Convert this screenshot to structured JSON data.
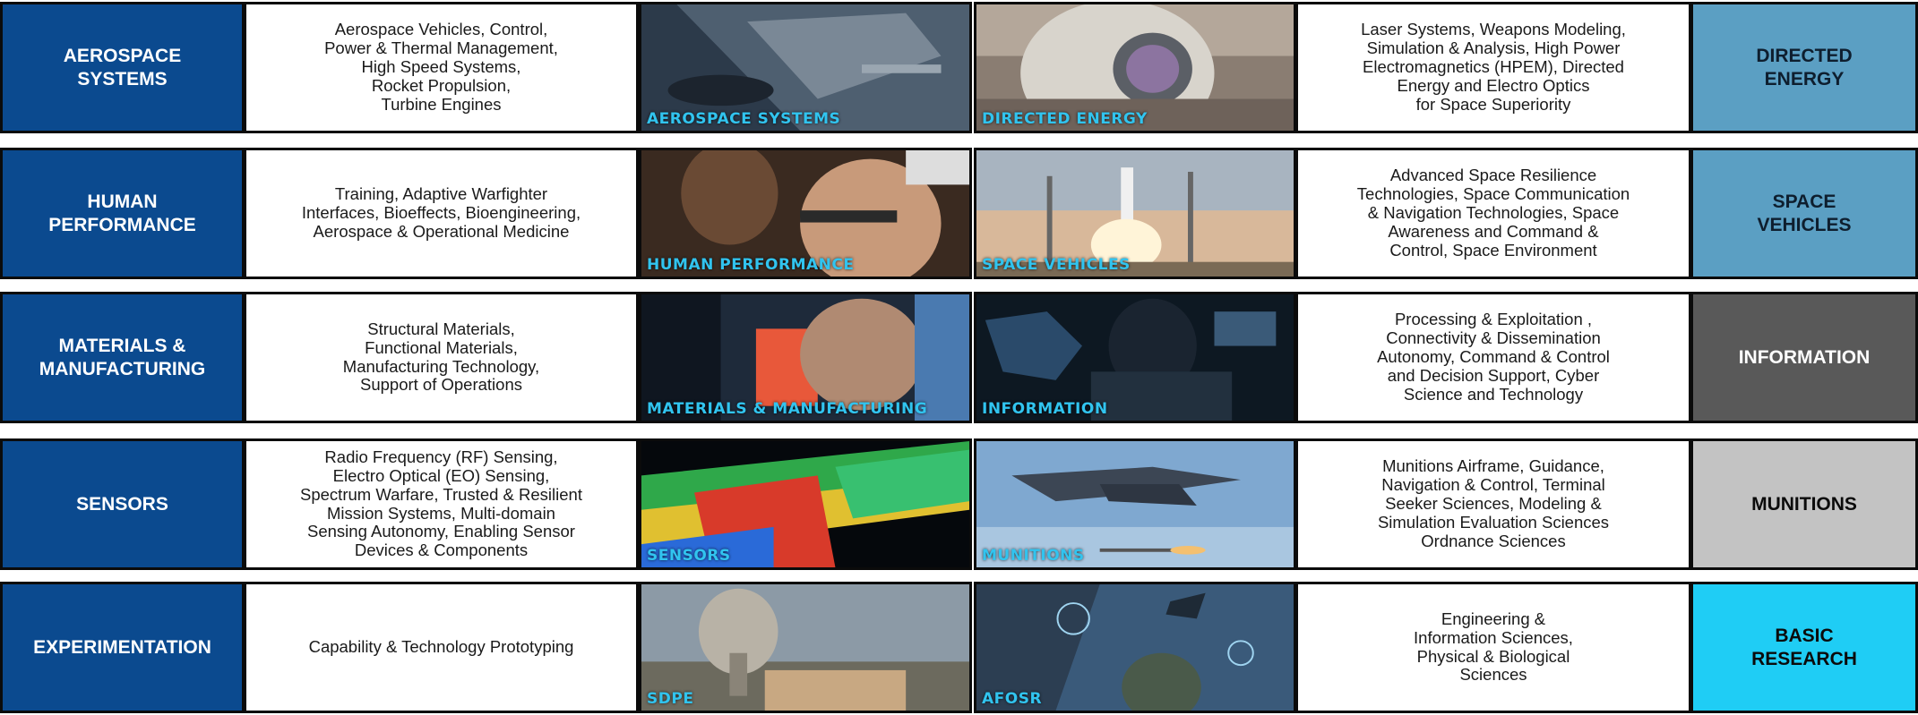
{
  "colors": {
    "left_label_bg": "#0b4a8f",
    "directed_energy_bg": "#5b9fc3",
    "space_vehicles_bg": "#5b9fc3",
    "information_bg": "#595959",
    "munitions_bg": "#c3c3c3",
    "basic_research_bg": "#1fcdf5",
    "caption_color": "#31c4ef"
  },
  "rows": [
    {
      "left_label": "AEROSPACE\nSYSTEMS",
      "left_desc": "Aerospace Vehicles, Control,\nPower & Thermal Management,\nHigh Speed Systems,\nRocket Propulsion,\nTurbine Engines",
      "left_image_caption": "AEROSPACE SYSTEMS",
      "right_image_caption": "DIRECTED ENERGY",
      "right_desc": "Laser Systems, Weapons Modeling,\nSimulation & Analysis, High Power\nElectromagnetics (HPEM), Directed\nEnergy and Electro Optics\nfor Space Superiority",
      "right_label": "DIRECTED\nENERGY"
    },
    {
      "left_label": "HUMAN\nPERFORMANCE",
      "left_desc": "Training, Adaptive Warfighter\nInterfaces, Bioeffects, Bioengineering,\nAerospace & Operational Medicine",
      "left_image_caption": "HUMAN PERFORMANCE",
      "right_image_caption": "SPACE VEHICLES",
      "right_desc": "Advanced Space Resilience\nTechnologies, Space Communication\n& Navigation Technologies, Space\nAwareness and Command &\nControl, Space Environment",
      "right_label": "SPACE\nVEHICLES"
    },
    {
      "left_label": "MATERIALS &\nMANUFACTURING",
      "left_desc": "Structural Materials,\nFunctional Materials,\nManufacturing Technology,\nSupport of Operations",
      "left_image_caption": "MATERIALS & MANUFACTURING",
      "right_image_caption": "INFORMATION",
      "right_desc": "Processing & Exploitation ,\nConnectivity & Dissemination\nAutonomy, Command & Control\nand Decision Support, Cyber\nScience and Technology",
      "right_label": "INFORMATION"
    },
    {
      "left_label": "SENSORS",
      "left_desc": "Radio Frequency (RF) Sensing,\nElectro Optical (EO) Sensing,\nSpectrum Warfare, Trusted & Resilient\nMission Systems, Multi-domain\nSensing Autonomy, Enabling Sensor\nDevices & Components",
      "left_image_caption": "SENSORS",
      "right_image_caption": "MUNITIONS",
      "right_desc": "Munitions Airframe, Guidance,\nNavigation & Control, Terminal\nSeeker Sciences, Modeling &\nSimulation Evaluation Sciences\nOrdnance Sciences",
      "right_label": "MUNITIONS"
    },
    {
      "left_label": "EXPERIMENTATION",
      "left_desc": "Capability & Technology Prototyping",
      "left_image_caption": "SDPE",
      "right_image_caption": "AFOSR",
      "right_desc": "Engineering &\nInformation Sciences,\nPhysical & Biological\nSciences",
      "right_label": "BASIC\nRESEARCH"
    }
  ]
}
